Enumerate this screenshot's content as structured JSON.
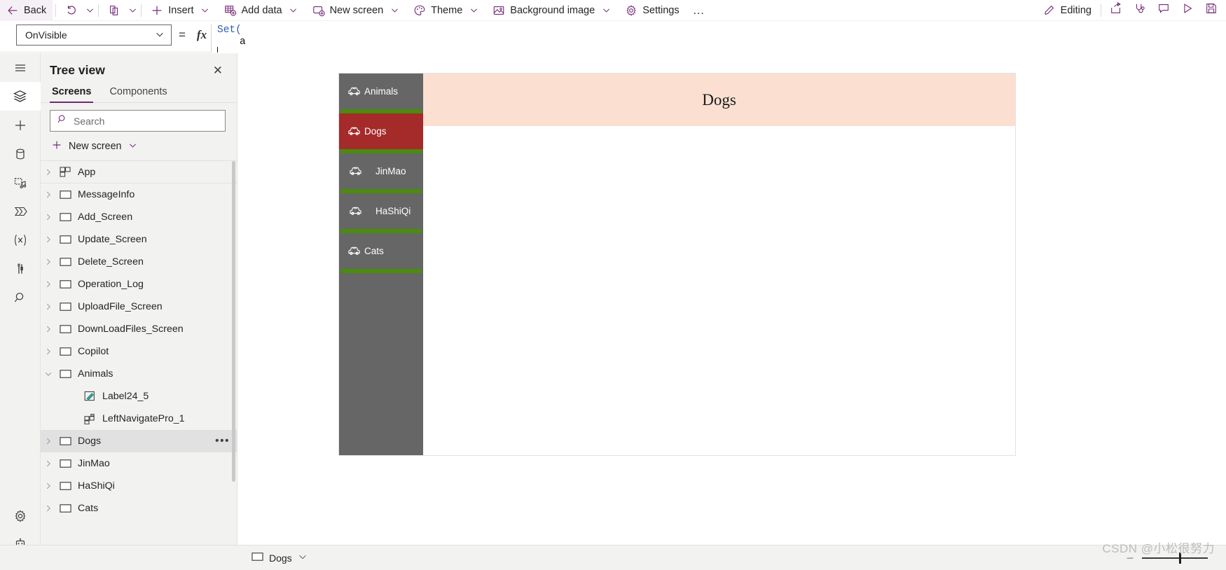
{
  "commandbar": {
    "back_label": "Back",
    "insert_label": "Insert",
    "add_data_label": "Add data",
    "new_screen_label": "New screen",
    "theme_label": "Theme",
    "background_image_label": "Background image",
    "settings_label": "Settings",
    "overflow_label": "…",
    "editing_label": "Editing",
    "icons": {
      "back": "arrow-left-icon",
      "undo": "undo-icon",
      "paste": "paste-icon",
      "insert": "plus-icon",
      "add_data": "table-add-icon",
      "new_screen": "screen-add-icon",
      "theme": "palette-icon",
      "background_image": "image-icon",
      "settings": "gear-icon",
      "editing": "pencil-icon",
      "share": "share-icon",
      "checker": "stethoscope-icon",
      "comments": "comment-icon",
      "preview": "play-icon",
      "save": "save-icon"
    }
  },
  "formulabar": {
    "property": "OnVisible",
    "equals": "=",
    "fx": "fx",
    "formula_line1": "Set(",
    "formula_line2": "a"
  },
  "rail": {
    "items": [
      {
        "name": "menu-icon",
        "label": "Menu"
      },
      {
        "name": "layers-icon",
        "label": "Tree view"
      },
      {
        "name": "plus-icon",
        "label": "Insert"
      },
      {
        "name": "database-icon",
        "label": "Data"
      },
      {
        "name": "media-icon",
        "label": "Media"
      },
      {
        "name": "power-automate-icon",
        "label": "Power Automate"
      },
      {
        "name": "variables-icon",
        "label": "Variables"
      },
      {
        "name": "tools-icon",
        "label": "App checker"
      },
      {
        "name": "search-icon",
        "label": "Search"
      }
    ],
    "bottom": [
      {
        "name": "gear-icon",
        "label": "Settings"
      },
      {
        "name": "copilot-robot-icon",
        "label": "Copilot"
      }
    ]
  },
  "treeview": {
    "title": "Tree view",
    "close_label": "✕",
    "tabs": [
      {
        "label": "Screens",
        "active": true
      },
      {
        "label": "Components",
        "active": false
      }
    ],
    "search_placeholder": "Search",
    "new_screen_label": "New screen",
    "items": [
      {
        "label": "App",
        "icon": "app-icon",
        "chevron": "right",
        "indent": 0,
        "selected": false,
        "more": false
      },
      {
        "label": "MessageInfo",
        "icon": "screen-icon",
        "chevron": "right",
        "indent": 0,
        "selected": false,
        "more": false
      },
      {
        "label": "Add_Screen",
        "icon": "screen-icon",
        "chevron": "right",
        "indent": 0,
        "selected": false,
        "more": false
      },
      {
        "label": "Update_Screen",
        "icon": "screen-icon",
        "chevron": "right",
        "indent": 0,
        "selected": false,
        "more": false
      },
      {
        "label": "Delete_Screen",
        "icon": "screen-icon",
        "chevron": "right",
        "indent": 0,
        "selected": false,
        "more": false
      },
      {
        "label": "Operation_Log",
        "icon": "screen-icon",
        "chevron": "right",
        "indent": 0,
        "selected": false,
        "more": false
      },
      {
        "label": "UploadFile_Screen",
        "icon": "screen-icon",
        "chevron": "right",
        "indent": 0,
        "selected": false,
        "more": false
      },
      {
        "label": "DownLoadFiles_Screen",
        "icon": "screen-icon",
        "chevron": "right",
        "indent": 0,
        "selected": false,
        "more": false
      },
      {
        "label": "Copilot",
        "icon": "screen-icon",
        "chevron": "right",
        "indent": 0,
        "selected": false,
        "more": false
      },
      {
        "label": "Animals",
        "icon": "screen-icon",
        "chevron": "down",
        "indent": 0,
        "selected": false,
        "more": false
      },
      {
        "label": "Label24_5",
        "icon": "label-icon",
        "chevron": "none",
        "indent": 1,
        "selected": false,
        "more": false
      },
      {
        "label": "LeftNavigatePro_1",
        "icon": "component-icon",
        "chevron": "none",
        "indent": 1,
        "selected": false,
        "more": false
      },
      {
        "label": "Dogs",
        "icon": "screen-icon",
        "chevron": "right",
        "indent": 0,
        "selected": true,
        "more": true
      },
      {
        "label": "JinMao",
        "icon": "screen-icon",
        "chevron": "right",
        "indent": 0,
        "selected": false,
        "more": false
      },
      {
        "label": "HaShiQi",
        "icon": "screen-icon",
        "chevron": "right",
        "indent": 0,
        "selected": false,
        "more": false
      },
      {
        "label": "Cats",
        "icon": "screen-icon",
        "chevron": "right",
        "indent": 0,
        "selected": false,
        "more": false
      }
    ]
  },
  "canvas": {
    "header_title": "Dogs",
    "nav_items": [
      {
        "label": "Animals",
        "active": false,
        "indent": false,
        "icon": "car-icon"
      },
      {
        "label": "Dogs",
        "active": true,
        "indent": false,
        "icon": "car-icon"
      },
      {
        "label": "JinMao",
        "active": false,
        "indent": true,
        "icon": "car-icon"
      },
      {
        "label": "HaShiQi",
        "active": false,
        "indent": true,
        "icon": "car-icon"
      },
      {
        "label": "Cats",
        "active": false,
        "indent": false,
        "icon": "car-icon"
      }
    ],
    "colors": {
      "nav_background": "#666666",
      "nav_active": "#a52a2a",
      "divider_green": "#4b8b0e",
      "header_background": "#fbdfd1",
      "body_background": "#ffffff"
    }
  },
  "statusbar": {
    "screen_label": "Dogs",
    "zoom_minus": "−",
    "watermark": "CSDN @小松很努力"
  }
}
